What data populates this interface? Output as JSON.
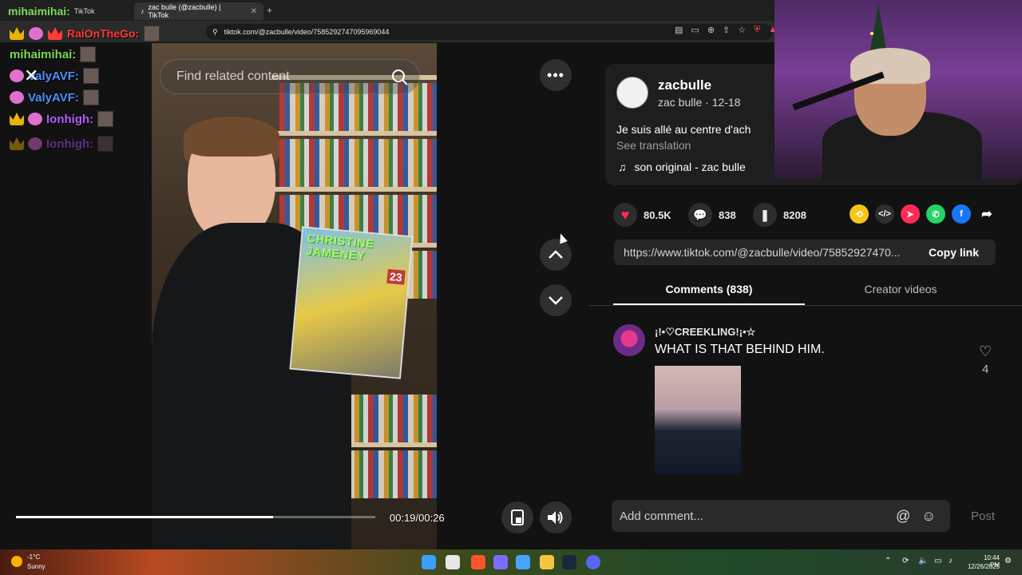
{
  "browser": {
    "tabs": [
      {
        "label": "TikTok",
        "active": false
      },
      {
        "label": "zac bulle (@zacbulle) | TikTok",
        "active": true
      }
    ],
    "new_tab": "+",
    "url": "tiktok.com/@zacbulle/video/7585292747095969044"
  },
  "chat": {
    "messages": [
      {
        "user": "mihaimihai:",
        "color": "#7ed957"
      },
      {
        "user": "RaiOnTheGo:",
        "color": "#ff3b3b"
      },
      {
        "user": "mihaimihai:",
        "color": "#7ed957"
      },
      {
        "user": "ValyAVF:",
        "color": "#4f8fff"
      },
      {
        "user": "ValyAVF:",
        "color": "#4f8fff"
      },
      {
        "user": "Ionhigh:",
        "color": "#b25cff"
      },
      {
        "user": "Ionhigh:",
        "color": "#6a3d8f"
      }
    ]
  },
  "video": {
    "search_placeholder": "Find related content",
    "comic_title": "CHRISTINE JAMENEY",
    "comic_number": "23",
    "timecode": "00:19/00:26",
    "progress": 0.715
  },
  "post": {
    "author": "zacbulle",
    "author_sub": "zac bulle · 12-18",
    "description": "Je suis allé au centre d'ach",
    "see_translation": "See translation",
    "sound": "son original - zac bulle",
    "likes": "80.5K",
    "comments": "838",
    "saves": "8208",
    "link": "https://www.tiktok.com/@zacbulle/video/75852927470...",
    "copy_link": "Copy link"
  },
  "tabs": {
    "comments": "Comments (838)",
    "creator": "Creator videos"
  },
  "comment": {
    "user": "¡!•♡CREEKLING!¡•☆",
    "text": "WHAT IS THAT BEHIND HIM.",
    "likes": "4"
  },
  "composer": {
    "placeholder": "Add comment...",
    "post": "Post"
  },
  "taskbar": {
    "temp": "-1°C",
    "condition": "Sunny",
    "time": "10:44 PM",
    "date": "12/26/2025"
  },
  "colors": {
    "like": "#fe2c55",
    "accent": "#fe2c55"
  }
}
